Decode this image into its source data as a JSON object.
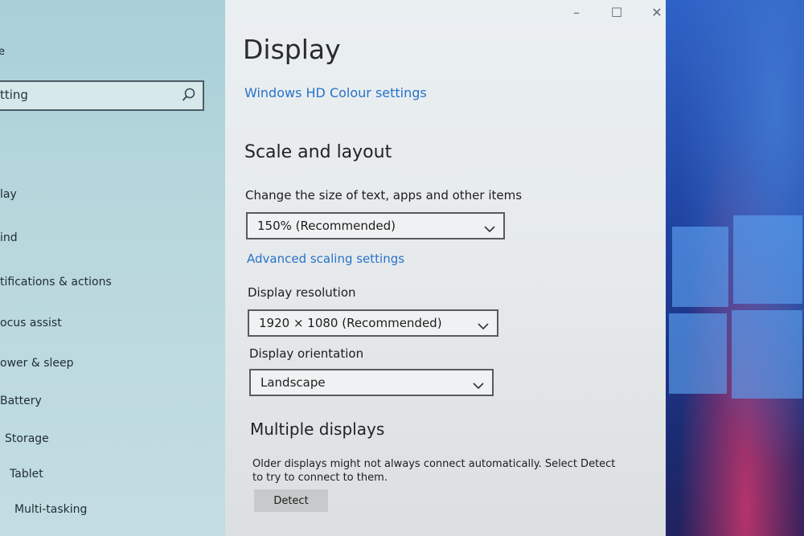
{
  "nav": {
    "home_glyph": "e",
    "search": {
      "value": "tting"
    },
    "items": [
      {
        "label": "lay"
      },
      {
        "label": "ind"
      },
      {
        "label": "tifications & actions"
      },
      {
        "label": "ocus assist"
      },
      {
        "label": "ower & sleep"
      },
      {
        "label": "Battery"
      },
      {
        "label": "Storage"
      },
      {
        "label": "Tablet"
      },
      {
        "label": "Multi-tasking"
      }
    ]
  },
  "window": {
    "minimize": "–",
    "maximize": "☐",
    "close": "✕"
  },
  "content": {
    "title": "Display",
    "hd_colour_link": "Windows HD Colour settings",
    "scale_layout": {
      "heading": "Scale and layout",
      "size_label": "Change the size of text, apps and other items",
      "size_value": "150% (Recommended)",
      "advanced_link": "Advanced scaling settings",
      "resolution_label": "Display resolution",
      "resolution_value": "1920 × 1080 (Recommended)",
      "orientation_label": "Display orientation",
      "orientation_value": "Landscape"
    },
    "multiple_displays": {
      "heading": "Multiple displays",
      "description": "Older displays might not always connect automatically. Select Detect to try to connect to them.",
      "detect_label": "Detect"
    }
  },
  "colors": {
    "accent_link": "#2872c8",
    "nav_background": "#b7d7dd",
    "content_background": "#e6eaec"
  }
}
